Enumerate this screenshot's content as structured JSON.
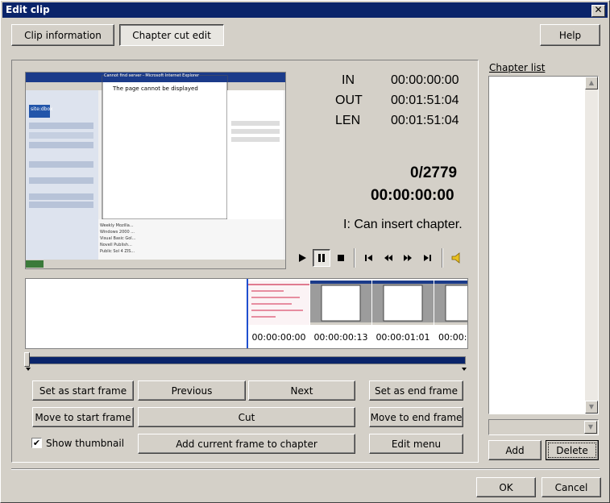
{
  "window": {
    "title": "Edit clip",
    "close_glyph": "✕"
  },
  "tabs": {
    "clip_info": "Clip information",
    "chapter_cut": "Chapter cut edit"
  },
  "help_label": "Help",
  "timecodes": {
    "in_label": "IN",
    "in_value": "00:00:00:00",
    "out_label": "OUT",
    "out_value": "00:01:51:04",
    "len_label": "LEN",
    "len_value": "00:01:51:04",
    "frame_counter": "0/2779",
    "current_time": "00:00:00:00",
    "status": "I: Can insert chapter."
  },
  "transport_icons": [
    "play-icon",
    "pause-icon",
    "stop-icon",
    "prev-frame-icon",
    "rewind-icon",
    "fast-forward-icon",
    "next-frame-icon",
    "speaker-icon"
  ],
  "thumbnails": [
    {
      "label": "00:00:00:00"
    },
    {
      "label": "00:00:00:13"
    },
    {
      "label": "00:00:01:01"
    },
    {
      "label": "00:00:0"
    }
  ],
  "buttons": {
    "set_start": "Set as start frame",
    "previous": "Previous",
    "next": "Next",
    "set_end": "Set as end frame",
    "move_start": "Move to start frame",
    "cut": "Cut",
    "move_end": "Move to end frame",
    "add_chapter": "Add current frame to chapter",
    "edit_menu": "Edit menu"
  },
  "show_thumbnail": {
    "label": "Show thumbnail",
    "checked": true
  },
  "chapter_list": {
    "title": "Chapter list",
    "add": "Add",
    "delete": "Delete"
  },
  "footer": {
    "ok": "OK",
    "cancel": "Cancel"
  },
  "preview": {
    "dialog_title": "Cannot find server - Microsoft Internet Explorer",
    "heading": "The page cannot be displayed",
    "logo": "site:dbox",
    "rows": [
      "Weekly Mozilla...",
      "Windows 2000 ...",
      "Visual Basic Gol...",
      "Novell Publish...",
      "Public Sol 4 ZIS..."
    ]
  }
}
